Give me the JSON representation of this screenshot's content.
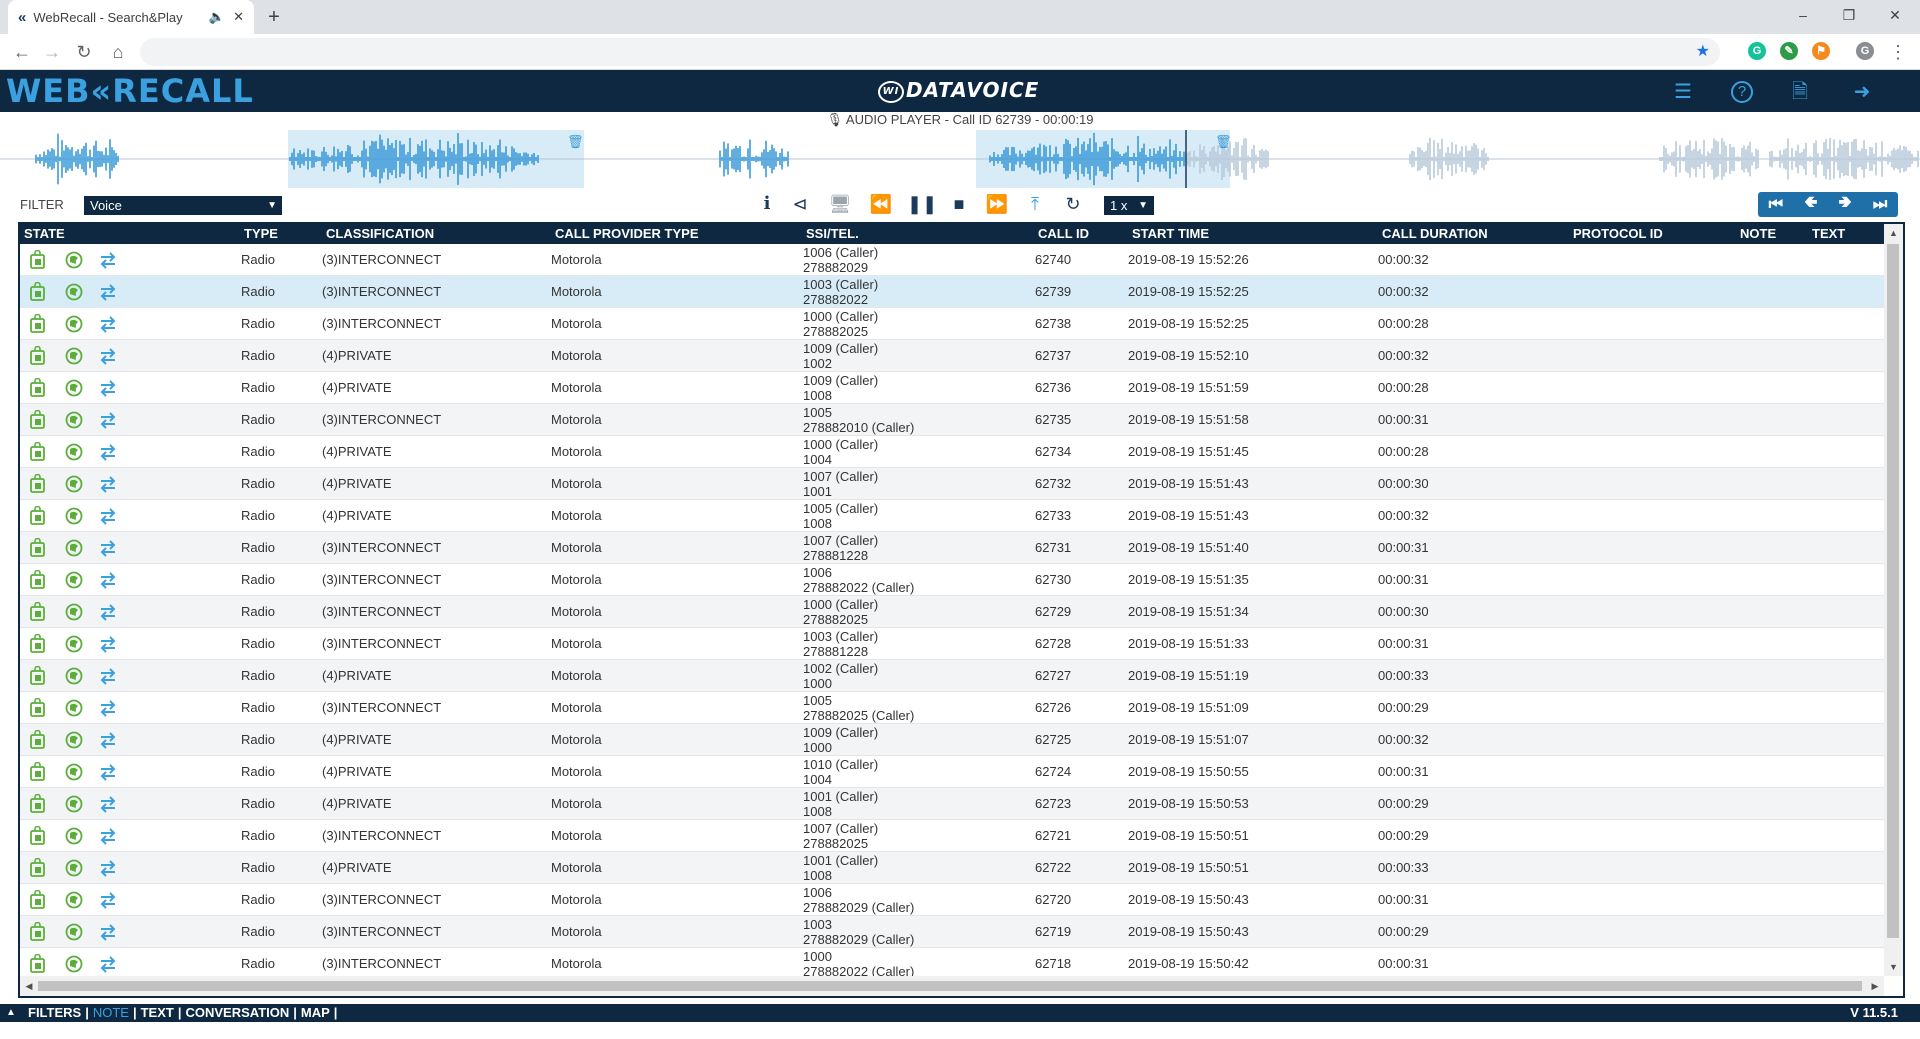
{
  "browser": {
    "tab_title": "WebRecall - Search&Play",
    "tab_favicon": "«",
    "new_tab": "+"
  },
  "header": {
    "logo": "WEB«RECALL",
    "brand": "DATAVOICE"
  },
  "player": {
    "title": "AUDIO PLAYER - Call ID 62739 -   00:00:19",
    "filter_label": "FILTER",
    "filter_value": "Voice",
    "speed": "1 x"
  },
  "table": {
    "headers": {
      "state": "STATE",
      "type": "TYPE",
      "classification": "CLASSIFICATION",
      "provider": "CALL PROVIDER TYPE",
      "ssi": "SSI/TEL.",
      "callid": "CALL ID",
      "start": "START TIME",
      "duration": "CALL DURATION",
      "protocol": "PROTOCOL ID",
      "note": "NOTE",
      "text": "TEXT"
    },
    "rows": [
      {
        "type": "Radio",
        "cls": "(3)INTERCONNECT",
        "prov": "Motorola",
        "ssi1": "1006 (Caller)",
        "ssi2": "278882029",
        "id": "62740",
        "start": "2019-08-19 15:52:26",
        "dur": "00:00:32"
      },
      {
        "type": "Radio",
        "cls": "(3)INTERCONNECT",
        "prov": "Motorola",
        "ssi1": "1003 (Caller)",
        "ssi2": "278882022",
        "id": "62739",
        "start": "2019-08-19 15:52:25",
        "dur": "00:00:32"
      },
      {
        "type": "Radio",
        "cls": "(3)INTERCONNECT",
        "prov": "Motorola",
        "ssi1": "1000 (Caller)",
        "ssi2": "278882025",
        "id": "62738",
        "start": "2019-08-19 15:52:25",
        "dur": "00:00:28"
      },
      {
        "type": "Radio",
        "cls": "(4)PRIVATE",
        "prov": "Motorola",
        "ssi1": "1009 (Caller)",
        "ssi2": "1002",
        "id": "62737",
        "start": "2019-08-19 15:52:10",
        "dur": "00:00:32"
      },
      {
        "type": "Radio",
        "cls": "(4)PRIVATE",
        "prov": "Motorola",
        "ssi1": "1009 (Caller)",
        "ssi2": "1008",
        "id": "62736",
        "start": "2019-08-19 15:51:59",
        "dur": "00:00:28"
      },
      {
        "type": "Radio",
        "cls": "(3)INTERCONNECT",
        "prov": "Motorola",
        "ssi1": "1005",
        "ssi2": "278882010 (Caller)",
        "id": "62735",
        "start": "2019-08-19 15:51:58",
        "dur": "00:00:31"
      },
      {
        "type": "Radio",
        "cls": "(4)PRIVATE",
        "prov": "Motorola",
        "ssi1": "1000 (Caller)",
        "ssi2": "1004",
        "id": "62734",
        "start": "2019-08-19 15:51:45",
        "dur": "00:00:28"
      },
      {
        "type": "Radio",
        "cls": "(4)PRIVATE",
        "prov": "Motorola",
        "ssi1": "1007 (Caller)",
        "ssi2": "1001",
        "id": "62732",
        "start": "2019-08-19 15:51:43",
        "dur": "00:00:30"
      },
      {
        "type": "Radio",
        "cls": "(4)PRIVATE",
        "prov": "Motorola",
        "ssi1": "1005 (Caller)",
        "ssi2": "1008",
        "id": "62733",
        "start": "2019-08-19 15:51:43",
        "dur": "00:00:32"
      },
      {
        "type": "Radio",
        "cls": "(3)INTERCONNECT",
        "prov": "Motorola",
        "ssi1": "1007 (Caller)",
        "ssi2": "278881228",
        "id": "62731",
        "start": "2019-08-19 15:51:40",
        "dur": "00:00:31"
      },
      {
        "type": "Radio",
        "cls": "(3)INTERCONNECT",
        "prov": "Motorola",
        "ssi1": "1006",
        "ssi2": "278882022 (Caller)",
        "id": "62730",
        "start": "2019-08-19 15:51:35",
        "dur": "00:00:31"
      },
      {
        "type": "Radio",
        "cls": "(3)INTERCONNECT",
        "prov": "Motorola",
        "ssi1": "1000 (Caller)",
        "ssi2": "278882025",
        "id": "62729",
        "start": "2019-08-19 15:51:34",
        "dur": "00:00:30"
      },
      {
        "type": "Radio",
        "cls": "(3)INTERCONNECT",
        "prov": "Motorola",
        "ssi1": "1003 (Caller)",
        "ssi2": "278881228",
        "id": "62728",
        "start": "2019-08-19 15:51:33",
        "dur": "00:00:31"
      },
      {
        "type": "Radio",
        "cls": "(4)PRIVATE",
        "prov": "Motorola",
        "ssi1": "1002 (Caller)",
        "ssi2": "1000",
        "id": "62727",
        "start": "2019-08-19 15:51:19",
        "dur": "00:00:33"
      },
      {
        "type": "Radio",
        "cls": "(3)INTERCONNECT",
        "prov": "Motorola",
        "ssi1": "1005",
        "ssi2": "278882025 (Caller)",
        "id": "62726",
        "start": "2019-08-19 15:51:09",
        "dur": "00:00:29"
      },
      {
        "type": "Radio",
        "cls": "(4)PRIVATE",
        "prov": "Motorola",
        "ssi1": "1009 (Caller)",
        "ssi2": "1000",
        "id": "62725",
        "start": "2019-08-19 15:51:07",
        "dur": "00:00:32"
      },
      {
        "type": "Radio",
        "cls": "(4)PRIVATE",
        "prov": "Motorola",
        "ssi1": "1010 (Caller)",
        "ssi2": "1004",
        "id": "62724",
        "start": "2019-08-19 15:50:55",
        "dur": "00:00:31"
      },
      {
        "type": "Radio",
        "cls": "(4)PRIVATE",
        "prov": "Motorola",
        "ssi1": "1001 (Caller)",
        "ssi2": "1008",
        "id": "62723",
        "start": "2019-08-19 15:50:53",
        "dur": "00:00:29"
      },
      {
        "type": "Radio",
        "cls": "(3)INTERCONNECT",
        "prov": "Motorola",
        "ssi1": "1007 (Caller)",
        "ssi2": "278882025",
        "id": "62721",
        "start": "2019-08-19 15:50:51",
        "dur": "00:00:29"
      },
      {
        "type": "Radio",
        "cls": "(4)PRIVATE",
        "prov": "Motorola",
        "ssi1": "1001 (Caller)",
        "ssi2": "1008",
        "id": "62722",
        "start": "2019-08-19 15:50:51",
        "dur": "00:00:33"
      },
      {
        "type": "Radio",
        "cls": "(3)INTERCONNECT",
        "prov": "Motorola",
        "ssi1": "1006",
        "ssi2": "278882029 (Caller)",
        "id": "62720",
        "start": "2019-08-19 15:50:43",
        "dur": "00:00:31"
      },
      {
        "type": "Radio",
        "cls": "(3)INTERCONNECT",
        "prov": "Motorola",
        "ssi1": "1003",
        "ssi2": "278882029 (Caller)",
        "id": "62719",
        "start": "2019-08-19 15:50:43",
        "dur": "00:00:29"
      },
      {
        "type": "Radio",
        "cls": "(3)INTERCONNECT",
        "prov": "Motorola",
        "ssi1": "1000",
        "ssi2": "278882022 (Caller)",
        "id": "62718",
        "start": "2019-08-19 15:50:42",
        "dur": "00:00:31"
      }
    ],
    "selected_row": 1
  },
  "footer": {
    "links": [
      "FILTERS",
      "NOTE",
      "TEXT",
      "CONVERSATION",
      "MAP"
    ],
    "active": "NOTE",
    "version": "V 11.5.1"
  },
  "colors": {
    "header_bg": "#0e2841",
    "accent": "#3aa0e0",
    "state_icon": "#5cae3a",
    "wave": "#3a9ad9",
    "wave_faded": "#b9c9da",
    "selected_row": "#d8ecf7"
  },
  "icons": {
    "state": [
      "recording-lock-icon",
      "globe-ear-icon",
      "transfer-arrows-icon"
    ],
    "player": [
      "info-icon",
      "share-icon",
      "monitor-icon",
      "rewind-icon",
      "pause-icon",
      "stop-icon",
      "fast-forward-icon",
      "upload-icon",
      "replay-icon"
    ],
    "header": [
      "settings-sliders-icon",
      "help-icon",
      "report-icon",
      "logout-icon"
    ],
    "nav": [
      "first-record-icon",
      "previous-record-icon",
      "next-record-icon",
      "last-record-icon"
    ]
  }
}
